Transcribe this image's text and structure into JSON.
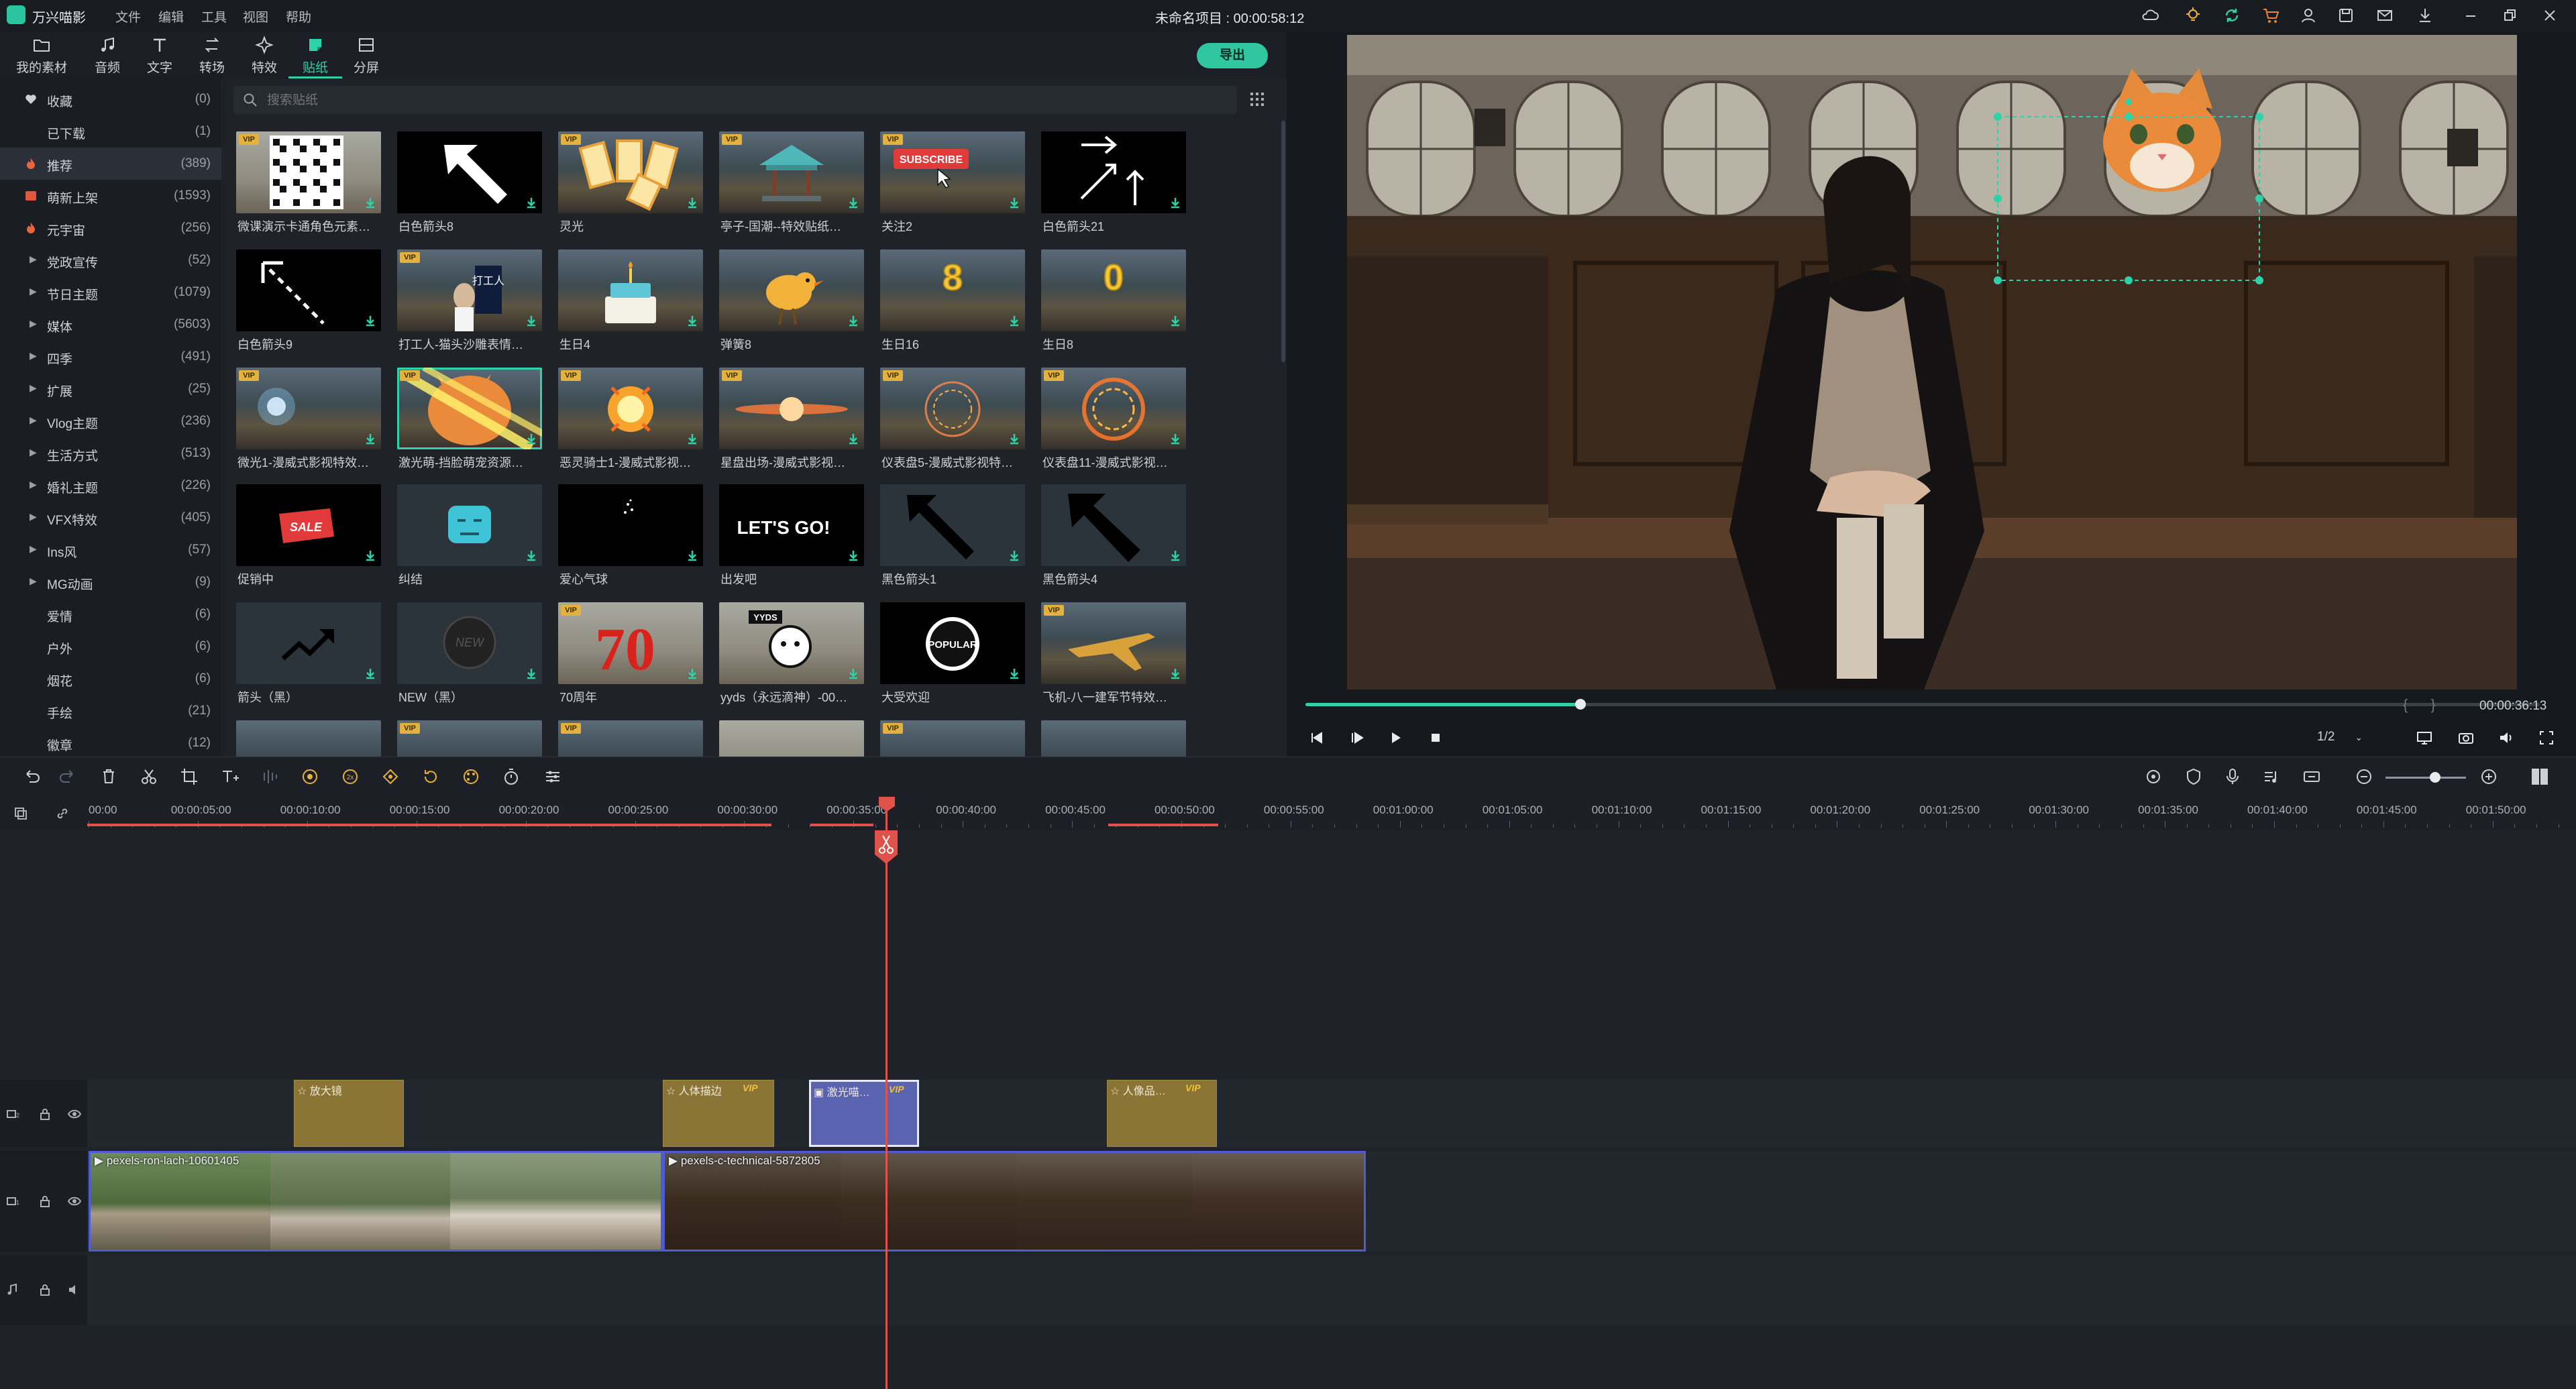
{
  "app": {
    "name": "万兴喵影",
    "project_title": "未命名项目 : 00:00:58:12"
  },
  "menu": [
    "文件",
    "编辑",
    "工具",
    "视图",
    "帮助"
  ],
  "resource_tabs": [
    {
      "label": "我的素材",
      "icon": "folder-icon"
    },
    {
      "label": "音频",
      "icon": "music-note-icon"
    },
    {
      "label": "文字",
      "icon": "text-icon"
    },
    {
      "label": "转场",
      "icon": "transition-icon"
    },
    {
      "label": "特效",
      "icon": "sparkle-icon"
    },
    {
      "label": "贴纸",
      "icon": "sticker-icon"
    },
    {
      "label": "分屏",
      "icon": "split-screen-icon"
    }
  ],
  "export_label": "导出",
  "categories": [
    {
      "label": "收藏",
      "count": "(0)",
      "icon": "heart"
    },
    {
      "label": "已下载",
      "count": "(1)"
    },
    {
      "label": "推荐",
      "count": "(389)",
      "icon": "fire"
    },
    {
      "label": "萌新上架",
      "count": "(1593)",
      "icon": "new"
    },
    {
      "label": "元宇宙",
      "count": "(256)",
      "icon": "fire"
    },
    {
      "label": "党政宣传",
      "count": "(52)",
      "arrow": true
    },
    {
      "label": "节日主题",
      "count": "(1079)",
      "arrow": true
    },
    {
      "label": "媒体",
      "count": "(5603)",
      "arrow": true
    },
    {
      "label": "四季",
      "count": "(491)",
      "arrow": true
    },
    {
      "label": "扩展",
      "count": "(25)",
      "arrow": true
    },
    {
      "label": "Vlog主题",
      "count": "(236)",
      "arrow": true
    },
    {
      "label": "生活方式",
      "count": "(513)",
      "arrow": true
    },
    {
      "label": "婚礼主题",
      "count": "(226)",
      "arrow": true
    },
    {
      "label": "VFX特效",
      "count": "(405)",
      "arrow": true
    },
    {
      "label": "Ins风",
      "count": "(57)",
      "arrow": true
    },
    {
      "label": "MG动画",
      "count": "(9)",
      "arrow": true
    },
    {
      "label": "爱情",
      "count": "(6)"
    },
    {
      "label": "户外",
      "count": "(6)"
    },
    {
      "label": "烟花",
      "count": "(6)"
    },
    {
      "label": "手绘",
      "count": "(21)"
    },
    {
      "label": "徽章",
      "count": "(12)"
    }
  ],
  "search": {
    "placeholder": "搜索贴纸"
  },
  "stickers": [
    {
      "label": "微课演示卡通角色元素…",
      "vip": true,
      "style": "pale",
      "art": "qr"
    },
    {
      "label": "白色箭头8",
      "vip": false,
      "style": "dark",
      "art": "arrow-up-left"
    },
    {
      "label": "灵光",
      "vip": true,
      "style": "scene",
      "art": "cards"
    },
    {
      "label": "亭子-国潮--特效贴纸…",
      "vip": true,
      "style": "scene",
      "art": "pavilion"
    },
    {
      "label": "关注2",
      "vip": true,
      "style": "scene",
      "art": "subscribe",
      "text": "SUBSCRIBE"
    },
    {
      "label": "白色箭头21",
      "vip": false,
      "style": "dark",
      "art": "arrows-up"
    },
    {
      "label": "白色箭头9",
      "vip": false,
      "style": "dark",
      "art": "dashed-arrow"
    },
    {
      "label": "打工人-猫头沙雕表情…",
      "vip": true,
      "style": "scene",
      "art": "worker",
      "text": "打工人"
    },
    {
      "label": "生日4",
      "vip": false,
      "style": "scene",
      "art": "cake"
    },
    {
      "label": "弹簧8",
      "vip": false,
      "style": "scene",
      "art": "bird"
    },
    {
      "label": "生日16",
      "vip": false,
      "style": "scene",
      "art": "digit",
      "text": "8"
    },
    {
      "label": "生日8",
      "vip": false,
      "style": "scene",
      "art": "digit",
      "text": "0"
    },
    {
      "label": "微光1-漫威式影视特效…",
      "vip": true,
      "style": "scene",
      "art": "spark"
    },
    {
      "label": "激光萌-挡脸萌宠资源…",
      "vip": true,
      "style": "scene",
      "art": "cat",
      "selected": true
    },
    {
      "label": "恶灵骑士1-漫威式影视…",
      "vip": true,
      "style": "scene",
      "art": "fire"
    },
    {
      "label": "星盘出场-漫威式影视…",
      "vip": true,
      "style": "scene",
      "art": "flare"
    },
    {
      "label": "仪表盘5-漫威式影视特…",
      "vip": true,
      "style": "scene",
      "art": "ring"
    },
    {
      "label": "仪表盘11-漫威式影视…",
      "vip": true,
      "style": "scene",
      "art": "ring2"
    },
    {
      "label": "促销中",
      "vip": false,
      "style": "dark",
      "art": "sale",
      "text": "SALE"
    },
    {
      "label": "纠结",
      "vip": false,
      "style": "plain",
      "art": "emoji"
    },
    {
      "label": "爱心气球",
      "vip": false,
      "style": "dark",
      "art": "dots"
    },
    {
      "label": "出发吧",
      "vip": false,
      "style": "dark",
      "art": "letsgo",
      "text": "LET'S GO!"
    },
    {
      "label": "黑色箭头1",
      "vip": false,
      "style": "plain",
      "art": "black-arrow"
    },
    {
      "label": "黑色箭头4",
      "vip": false,
      "style": "plain",
      "art": "black-arrow-thick"
    },
    {
      "label": "箭头（黑）",
      "vip": false,
      "style": "plain",
      "art": "trend"
    },
    {
      "label": "NEW（黑）",
      "vip": false,
      "style": "plain",
      "art": "new-badge",
      "text": "NEW"
    },
    {
      "label": "70周年",
      "vip": true,
      "style": "pale",
      "art": "seventy",
      "text": "70"
    },
    {
      "label": "yyds（永远滴神）-00…",
      "vip": false,
      "style": "pale",
      "art": "yyds",
      "text": "YYDS"
    },
    {
      "label": "大受欢迎",
      "vip": false,
      "style": "dark",
      "art": "popular",
      "text": "POPULAR"
    },
    {
      "label": "飞机-八一建军节特效…",
      "vip": true,
      "style": "scene",
      "art": "plane"
    },
    {
      "label": "",
      "vip": false,
      "style": "scene",
      "art": "none"
    },
    {
      "label": "",
      "vip": true,
      "style": "scene",
      "art": "none"
    },
    {
      "label": "",
      "vip": true,
      "style": "scene",
      "art": "none"
    },
    {
      "label": "",
      "vip": false,
      "style": "pale",
      "art": "none"
    },
    {
      "label": "",
      "vip": true,
      "style": "scene",
      "art": "none"
    },
    {
      "label": "",
      "vip": false,
      "style": "scene",
      "art": "none"
    }
  ],
  "player": {
    "current_time": "00:00:36:13",
    "ratio": "1/2",
    "progress": 0.223,
    "bracket_left": "{",
    "bracket_right": "}"
  },
  "ruler": {
    "labels": [
      "00:00",
      "00:00:05:00",
      "00:00:10:00",
      "00:00:15:00",
      "00:00:20:00",
      "00:00:25:00",
      "00:00:30:00",
      "00:00:35:00",
      "00:00:40:00",
      "00:00:45:00",
      "00:00:50:00",
      "00:00:55:00",
      "00:01:00:00",
      "00:01:05:00",
      "00:01:10:00",
      "00:01:15:00",
      "00:01:20:00",
      "00:01:25:00",
      "00:01:30:00",
      "00:01:35:00",
      "00:01:40:00",
      "00:01:45:00",
      "00:01:50:00"
    ]
  },
  "tracks": {
    "sticker_clips": [
      {
        "title": "放大镜",
        "vip": false,
        "selected": false
      },
      {
        "title": "人体描边",
        "vip": true,
        "selected": false
      },
      {
        "title": "激光喵…",
        "vip": true,
        "selected": true
      },
      {
        "title": "人像品…",
        "vip": true,
        "selected": false
      }
    ],
    "video_clips": [
      {
        "title": "pexels-ron-lach-10601405"
      },
      {
        "title": "pexels-c-technical-5872805"
      }
    ],
    "vip_label": "VIP"
  },
  "colors": {
    "accent": "#2fd1a8",
    "playhead": "#e0514a",
    "sticker_clip": "#8a7436",
    "video_border": "#4f5bd1",
    "vip": "#e3b13c"
  }
}
